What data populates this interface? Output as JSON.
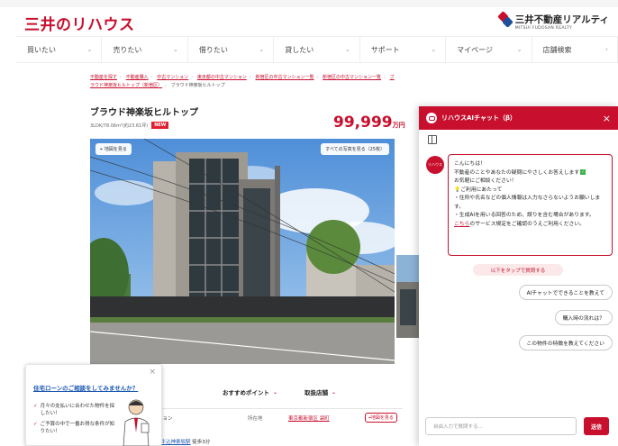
{
  "header": {
    "logo": "三井のリハウス",
    "brand_name": "三井不動産リアルティ",
    "brand_sub": "MITSUI FUDOSAN REALTY"
  },
  "nav": {
    "items": [
      {
        "label": "買いたい"
      },
      {
        "label": "売りたい"
      },
      {
        "label": "借りたい"
      },
      {
        "label": "貸したい"
      },
      {
        "label": "サポート"
      },
      {
        "label": "マイページ"
      },
      {
        "label": "店舗検索"
      }
    ]
  },
  "breadcrumb": {
    "items": [
      "不動産を探す",
      "不動産購入",
      "中古マンション",
      "東京都の中古マンション",
      "新宿区の中古マンション一覧",
      "新宿区の中古マンション一覧",
      "ブラウド神楽坂ヒルトップ（新宿区）"
    ],
    "current": "ブラウド神楽坂ヒルトップ"
  },
  "listing": {
    "title": "ブラウド神楽坂ヒルトップ",
    "meta": "3LDK/78.06m²(約23.61坪)",
    "new_badge": "NEW",
    "price_value": "99,999",
    "price_unit": "万円",
    "photo_btn_map": "地図を見る",
    "photo_btn_all": "すべての写真を見る（25枚）"
  },
  "lower": {
    "tab_recommend": "おすすめポイント",
    "tab_store": "取扱店舗",
    "row_label": "ション",
    "row_key": "所在地",
    "row_value": "東京都新宿区 袋町",
    "row_btn": "地図を見る",
    "foot_prefix": "線",
    "foot_link": "牛込神楽坂駅",
    "foot_suffix": " 徒歩3分"
  },
  "loan_popup": {
    "title": "住宅ローンのご相談をしてみませんか？",
    "items": [
      "月々の支払いに合わせた物件を探したい！",
      "ご予算の中で一番お得な条件が知りたい！"
    ]
  },
  "chat": {
    "title": "リハウスAIチャット（β）",
    "avatar_text": "リハウス",
    "greeting": "こんにちは！",
    "line1": "不動産のことやあなたの疑問にやさしくお答えします",
    "line2": "お気軽にご相談ください！",
    "line3": "ご利用にあたって",
    "line4": "・住所や氏名などの個人情報は入力なさらないようお願いします。",
    "line5": "・生成AIを用いる回答のため、誤りを含む場合があります。",
    "link": "こちら",
    "line6": "のサービス規定をご確認のうえご利用ください。",
    "hint": "以下をタップで質問する",
    "suggestions": [
      "AIチャットでできることを教えて",
      "購入時の流れは？",
      "この物件の特徴を教えてください"
    ],
    "input_placeholder": "自由入力で質問する...",
    "send_label": "送信"
  },
  "colors": {
    "accent": "#c8102e",
    "link": "#1a56b0"
  }
}
